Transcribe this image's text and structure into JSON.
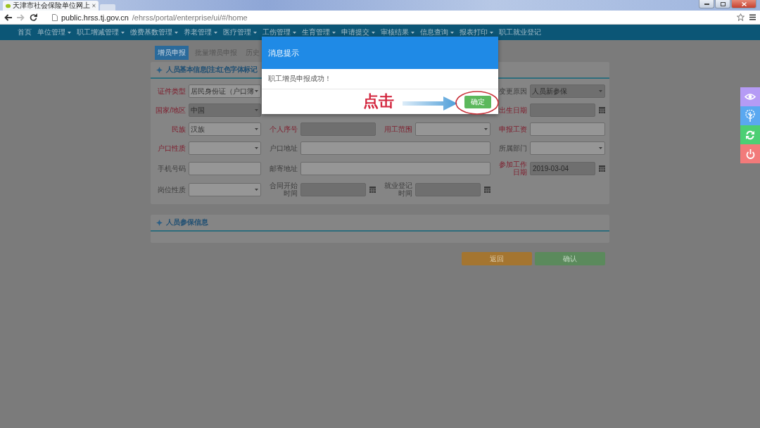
{
  "browser": {
    "tab_title": "天津市社会保险单位网上",
    "url_host": "public.hrss.tj.gov.cn",
    "url_path": "/ehrss/portal/enterprise/ui/#/home"
  },
  "nav": [
    {
      "label": "首页",
      "dropdown": false
    },
    {
      "label": "单位管理",
      "dropdown": true
    },
    {
      "label": "职工增减管理",
      "dropdown": true
    },
    {
      "label": "缴费基数管理",
      "dropdown": true
    },
    {
      "label": "养老管理",
      "dropdown": true
    },
    {
      "label": "医疗管理",
      "dropdown": true
    },
    {
      "label": "工伤管理",
      "dropdown": true
    },
    {
      "label": "生育管理",
      "dropdown": true
    },
    {
      "label": "申请提交",
      "dropdown": true
    },
    {
      "label": "审核结果",
      "dropdown": true
    },
    {
      "label": "信息查询",
      "dropdown": true
    },
    {
      "label": "报表打印",
      "dropdown": true
    },
    {
      "label": "职工就业登记",
      "dropdown": false
    }
  ],
  "tabs": [
    {
      "label": "增员申报",
      "selected": true
    },
    {
      "label": "批量增员申报",
      "selected": false
    },
    {
      "label": "历史",
      "selected": false
    }
  ],
  "section_basic": {
    "title": "人员基本信息(注:红色字体标记"
  },
  "form_rows": [
    [
      {
        "kind": "select",
        "label": "证件类型",
        "value": "居民身份证（户口簿",
        "required": true,
        "disabled": false
      },
      {
        "kind": "covered"
      },
      {
        "kind": "covered"
      },
      {
        "kind": "select",
        "label": "变更原因",
        "value": "人员新参保",
        "required": false,
        "disabled": true
      }
    ],
    [
      {
        "kind": "select",
        "label": "国家/地区",
        "value": "中国",
        "required": true,
        "disabled": true
      },
      {
        "kind": "covered"
      },
      {
        "kind": "covered"
      },
      {
        "kind": "date",
        "label": "出生日期",
        "required": true,
        "disabled": true
      }
    ],
    [
      {
        "kind": "select",
        "label": "民族",
        "value": "汉族",
        "required": true,
        "disabled": false
      },
      {
        "kind": "text",
        "label": "个人序号",
        "required": true,
        "disabled": true
      },
      {
        "kind": "select",
        "label": "用工范围",
        "required": true,
        "disabled": false
      },
      {
        "kind": "text",
        "label": "申报工资",
        "required": true,
        "disabled": false
      }
    ],
    [
      {
        "kind": "select",
        "label": "户口性质",
        "required": true,
        "disabled": false
      },
      {
        "kind": "wide",
        "label": "户口地址",
        "required": false,
        "disabled": false
      },
      {
        "kind": "select",
        "label": "所属部门",
        "required": false,
        "disabled": false
      }
    ],
    [
      {
        "kind": "text",
        "label": "手机号码",
        "required": false,
        "disabled": false
      },
      {
        "kind": "wide",
        "label": "邮寄地址",
        "required": false,
        "disabled": false
      },
      {
        "kind": "date",
        "label": "参加工作日期",
        "value": "2019-03-04",
        "required": true,
        "disabled": true
      }
    ],
    [
      {
        "kind": "select",
        "label": "岗位性质",
        "required": false,
        "disabled": false
      },
      {
        "kind": "date",
        "label": "合同开始时间",
        "required": false,
        "disabled": true
      },
      {
        "kind": "date",
        "label": "就业登记时间",
        "required": false,
        "disabled": true
      }
    ]
  ],
  "section_insurance": {
    "title": "人员参保信息"
  },
  "actions": [
    {
      "label": "返回",
      "kind": "back"
    },
    {
      "label": "确认",
      "kind": "confirm"
    }
  ],
  "dialog": {
    "title": "消息提示",
    "message": "职工增员申报成功！",
    "button": "确定"
  },
  "annotation": {
    "text": "点击"
  },
  "side_toolbar": [
    {
      "color": "#b59bf5"
    },
    {
      "color": "#5aa8f0"
    },
    {
      "color": "#4ccf74"
    },
    {
      "color": "#f27a7a"
    }
  ]
}
